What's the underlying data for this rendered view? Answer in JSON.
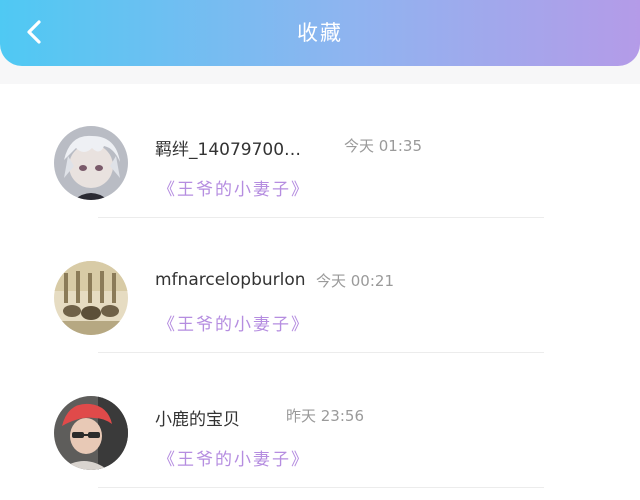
{
  "header": {
    "title": "收藏",
    "back_icon": "chevron-left-icon",
    "gradient": [
      "#4fc9f3",
      "#b49be8"
    ]
  },
  "favorites": [
    {
      "username": "羁绊_14079700…",
      "time": "今天 01:35",
      "book": "《王爷的小妻子》",
      "avatar": "anime-character-avatar"
    },
    {
      "username": "mfnarcelopburlon",
      "time": "今天 00:21",
      "book": "《王爷的小妻子》",
      "avatar": "vintage-photo-avatar"
    },
    {
      "username": "小鹿的宝贝",
      "time": "昨天 23:56",
      "book": "《王爷的小妻子》",
      "avatar": "red-hair-person-avatar"
    }
  ],
  "colors": {
    "book_title": "#b58de0",
    "time": "#9a9a9a",
    "username": "#333333"
  }
}
